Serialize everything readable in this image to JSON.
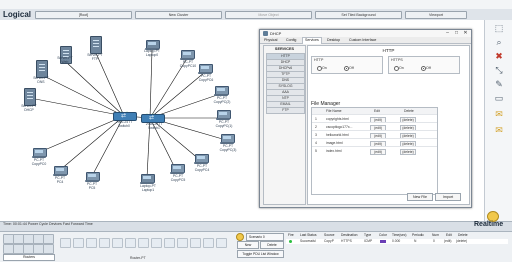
{
  "top": {
    "logical_label": "Logical",
    "root_label": "[Root]",
    "new_cluster": "New Cluster",
    "move_object": "Move Object",
    "set_tiled_bg": "Set Tiled Background",
    "viewport": "Viewport"
  },
  "devices": {
    "server_ftp": "Server-PT\nFTP",
    "server_dns": "Server-PT\nDNS",
    "server_web": "Server-PT\nWeb",
    "server_dhcp": "Server-PT\nDHCP",
    "switch0": "2960-24TT\nSwitch0",
    "switch1": "2960-24TT\nSwitch1",
    "pc_top1": "PC-PT\nCopyPC10",
    "pc_top2": "PC-PT\nCopyPC6",
    "pc_right1": "PC-PT\nCopyPC(2)",
    "pc_right2": "PC-PT\nCopyPC(1)",
    "pc_right3": "PC-PT\nCopyPC(3)",
    "pc_right4": "PC-PT\nCopyPC4",
    "pc_bottom1": "Laptop-PT\nLaptop1",
    "pc_bottom2": "PC-PT\nCopyPC5",
    "pc_left1": "PC-PT\nCopyPC0",
    "pc_left2": "PC-PT\nPC4",
    "pc_left3": "PC-PT\nPC5",
    "laptop_top": "Laptop-PT\nLaptop0"
  },
  "time": {
    "text": "Time: 00:01:44   Power Cycle Devices  Fast Forward Time",
    "realtime": "Realtime"
  },
  "bottom": {
    "category": "Routers",
    "device_label": "Router-PT",
    "scenario": "Scenario 0",
    "new_btn": "New",
    "delete_btn": "Delete",
    "toggle_pdu": "Toggle PDU List Window",
    "pdu_headers": [
      "Fire",
      "Last Status",
      "Source",
      "Destination",
      "Type",
      "Color",
      "Time(sec)",
      "Periodic",
      "Num",
      "Edit",
      "Delete"
    ],
    "pdu_row": [
      "Successful",
      "CopyP",
      "HTTPS",
      "ICMP",
      "",
      "0.000",
      "N",
      "0",
      "(edit)",
      "(delete)"
    ]
  },
  "dialog": {
    "title": "DHCP",
    "tabs": [
      "Physical",
      "Config",
      "Services",
      "Desktop",
      "Custom Interface"
    ],
    "services_header": "SERVICES",
    "services": [
      "HTTP",
      "DHCP",
      "DHCPv6",
      "TFTP",
      "DNS",
      "SYSLOG",
      "AAA",
      "NTP",
      "EMAIL",
      "FTP"
    ],
    "http_title": "HTTP",
    "http_label": "HTTP",
    "https_label": "HTTPS",
    "on": "On",
    "off": "Off",
    "file_manager": "File Manager",
    "fm_headers": [
      "File Name",
      "Edit",
      "Delete"
    ],
    "files": [
      {
        "num": "1",
        "name": "copyrights.html",
        "edit": "(edit)",
        "del": "(delete)"
      },
      {
        "num": "2",
        "name": "cscoptlogo177x...",
        "edit": "(edit)",
        "del": "(delete)"
      },
      {
        "num": "3",
        "name": "helloworld.html",
        "edit": "(edit)",
        "del": "(delete)"
      },
      {
        "num": "4",
        "name": "image.html",
        "edit": "(edit)",
        "del": "(delete)"
      },
      {
        "num": "5",
        "name": "index.html",
        "edit": "(edit)",
        "del": "(delete)"
      }
    ],
    "new_file": "New File",
    "import": "Import"
  }
}
